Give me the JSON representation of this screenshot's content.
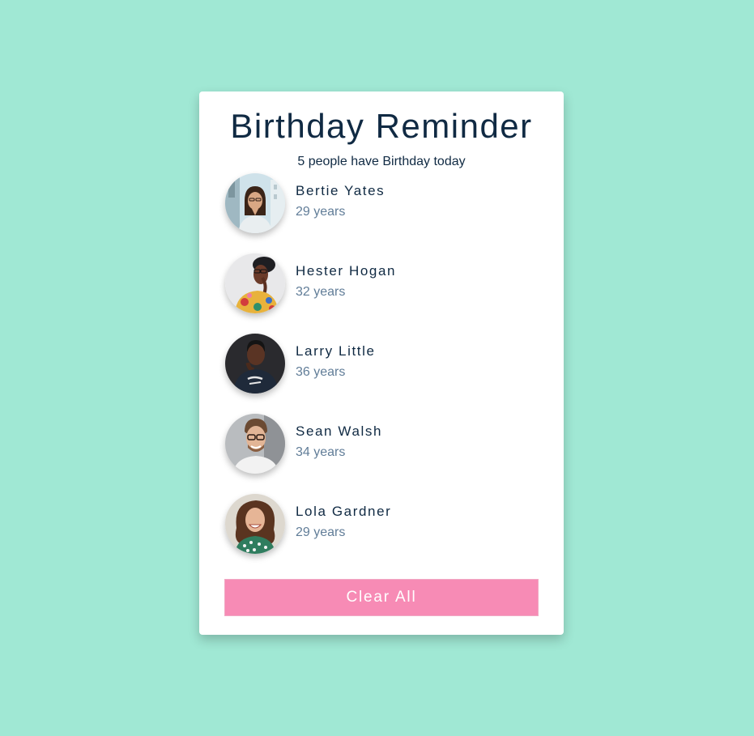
{
  "app": {
    "title": "Birthday Reminder",
    "subtitle": "5 people have Birthday today"
  },
  "people": [
    {
      "name": "Bertie Yates",
      "age": "29 years",
      "avatar_icon": "avatar-photo-icon"
    },
    {
      "name": "Hester Hogan",
      "age": "32 years",
      "avatar_icon": "avatar-photo-icon"
    },
    {
      "name": "Larry Little",
      "age": "36 years",
      "avatar_icon": "avatar-photo-icon"
    },
    {
      "name": "Sean Walsh",
      "age": "34 years",
      "avatar_icon": "avatar-photo-icon"
    },
    {
      "name": "Lola Gardner",
      "age": "29 years",
      "avatar_icon": "avatar-photo-icon"
    }
  ],
  "actions": {
    "clear_label": "Clear All"
  },
  "colors": {
    "background": "#a0e8d4",
    "card": "#ffffff",
    "primary_text": "#102a43",
    "secondary_text": "#617d98",
    "button": "#f78bb5"
  }
}
